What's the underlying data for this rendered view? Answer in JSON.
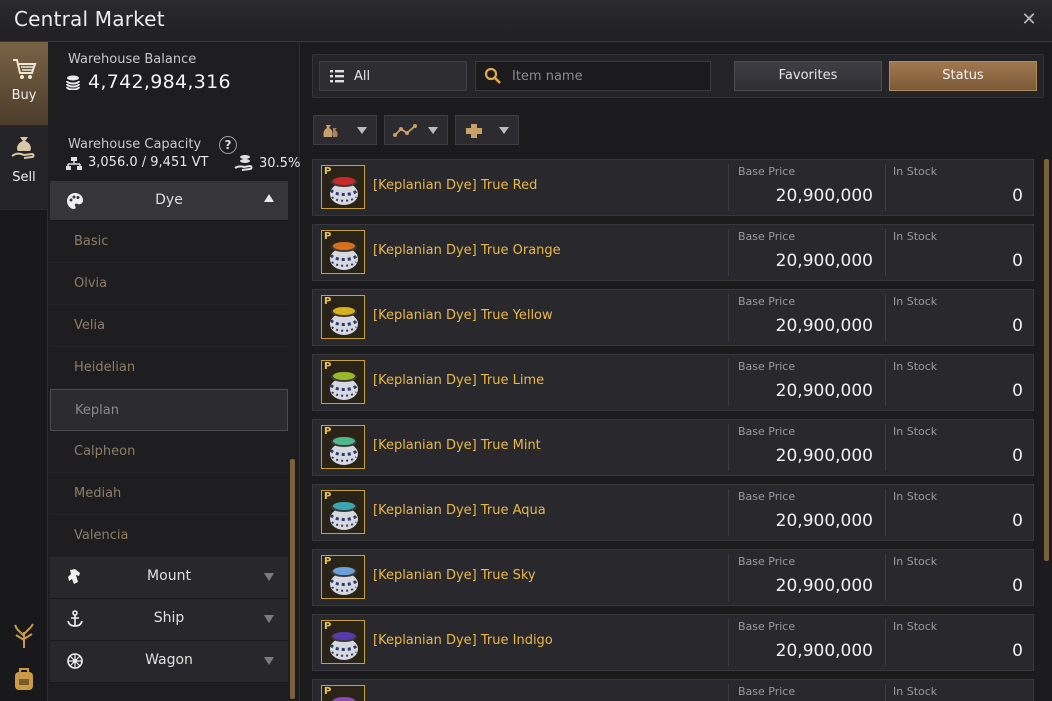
{
  "window": {
    "title": "Central Market",
    "close_icon": "✕"
  },
  "rail": {
    "buy_label": "Buy",
    "sell_label": "Sell",
    "bottom_icons": [
      "tree-icon",
      "backpack-icon"
    ]
  },
  "warehouse": {
    "balance_label": "Warehouse Balance",
    "balance": "4,742,984,316",
    "capacity_label": "Warehouse Capacity",
    "help_symbol": "?",
    "capacity": "3,056.0 / 9,451 VT",
    "percent": "30.5%"
  },
  "categories": {
    "expanded": {
      "name": "Dye",
      "icon": "palette-icon"
    },
    "subitems": [
      "Basic",
      "Olvia",
      "Velia",
      "Heidelian",
      "Keplan",
      "Calpheon",
      "Mediah",
      "Valencia"
    ],
    "selected_subitem": "Keplan",
    "collapsed": [
      {
        "name": "Mount",
        "icon": "horse-icon"
      },
      {
        "name": "Ship",
        "icon": "anchor-icon"
      },
      {
        "name": "Wagon",
        "icon": "wheel-icon"
      }
    ]
  },
  "toolbar": {
    "filter_label": "All",
    "search_placeholder": "Item name",
    "favorites_label": "Favorites",
    "status_label": "Status"
  },
  "sort_buttons": [
    "money-bag-icon",
    "trend-line-icon",
    "plus-cross-icon"
  ],
  "columns": {
    "price_label": "Base Price",
    "stock_label": "In Stock"
  },
  "items": [
    {
      "name": "[Keplanian Dye] True Red",
      "price": "20,900,000",
      "stock": "0",
      "color": "#c8282a"
    },
    {
      "name": "[Keplanian Dye] True Orange",
      "price": "20,900,000",
      "stock": "0",
      "color": "#d8701e"
    },
    {
      "name": "[Keplanian Dye] True Yellow",
      "price": "20,900,000",
      "stock": "0",
      "color": "#d8b020"
    },
    {
      "name": "[Keplanian Dye] True Lime",
      "price": "20,900,000",
      "stock": "0",
      "color": "#9ab82a"
    },
    {
      "name": "[Keplanian Dye] True Mint",
      "price": "20,900,000",
      "stock": "0",
      "color": "#4fb88a"
    },
    {
      "name": "[Keplanian Dye] True Aqua",
      "price": "20,900,000",
      "stock": "0",
      "color": "#3aa8b0"
    },
    {
      "name": "[Keplanian Dye] True Sky",
      "price": "20,900,000",
      "stock": "0",
      "color": "#6aa0d8"
    },
    {
      "name": "[Keplanian Dye] True Indigo",
      "price": "20,900,000",
      "stock": "0",
      "color": "#5a3ab0"
    },
    {
      "name": "",
      "price": "",
      "stock": "",
      "color": "#8a4ab8"
    }
  ],
  "colors": {
    "accent_gold": "#e8b84a",
    "status_button": "#a0784f",
    "buy_tab": "#7a6346"
  }
}
